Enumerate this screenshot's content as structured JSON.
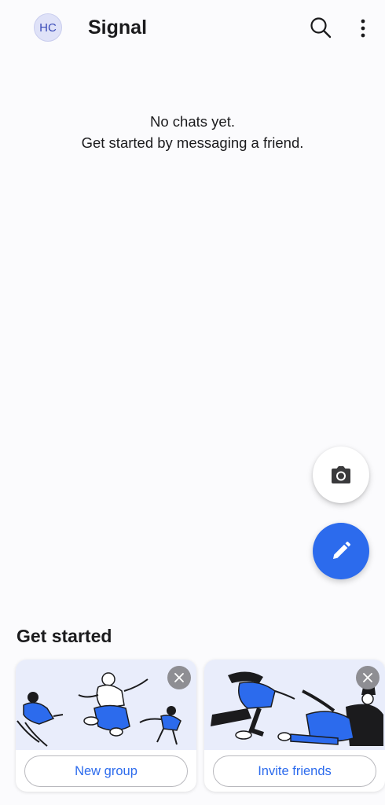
{
  "header": {
    "avatar_initials": "HC",
    "title": "Signal",
    "icons": {
      "search": "search-icon",
      "menu": "more-vertical-icon"
    }
  },
  "empty_state": {
    "line1": "No chats yet.",
    "line2": "Get started by messaging a friend."
  },
  "fabs": {
    "camera_icon": "camera-icon",
    "compose_icon": "pencil-icon",
    "compose_color": "#2c6bed"
  },
  "get_started": {
    "title": "Get started",
    "cards": [
      {
        "button_label": "New group",
        "close_icon": "close-icon"
      },
      {
        "button_label": "Invite friends",
        "close_icon": "close-icon"
      }
    ]
  },
  "colors": {
    "accent": "#2c6bed",
    "background": "#fbfbfd",
    "avatar_bg": "#dfe2f8"
  }
}
